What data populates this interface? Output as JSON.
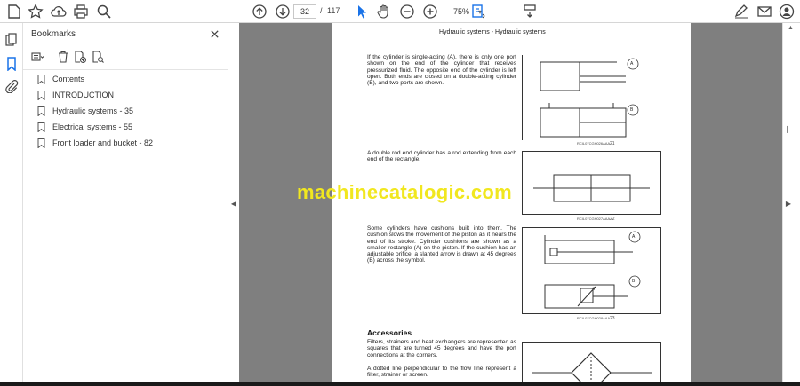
{
  "toolbar": {
    "current_page": "32",
    "page_separator": "/",
    "total_pages": "117",
    "zoom": "75%"
  },
  "bookmarks": {
    "title": "Bookmarks",
    "items": [
      {
        "label": "Contents"
      },
      {
        "label": "INTRODUCTION"
      },
      {
        "label": "Hydraulic systems - 35"
      },
      {
        "label": "Electrical systems - 55"
      },
      {
        "label": "Front loader and bucket - 82"
      }
    ]
  },
  "document": {
    "header": "Hydraulic systems - Hydraulic systems",
    "para1": "If the cylinder is single-acting (A), there is only one port shown on the end of the cylinder that receives pressurized fluid. The opposite end of the cylinder is left open. Both ends are closed on a double-acting cylinder (B), and two ports are shown.",
    "fig1_caption": "RCIL07CGH026AAA",
    "fig1_number": "21",
    "fig1_label_a": "A",
    "fig1_label_b": "B",
    "para2": "A double rod end cylinder has a rod extending from each end of the rectangle.",
    "fig2_caption": "RCIL07CGH027AAA",
    "fig2_number": "22",
    "para3": "Some cylinders have cushions built into them. The cushion slows the movement of the piston as it nears the end of its stroke. Cylinder cushions are shown as a smaller rectangle (A) on the piston. If the cushion has an adjustable orifice, a slanted arrow is drawn at 45 degrees (B) across the symbol.",
    "fig3_caption": "RCIL07CGH028AAA",
    "fig3_number": "23",
    "fig3_label_a": "A",
    "fig3_label_b": "B",
    "accessories_heading": "Accessories",
    "para4": "Filters, strainers and heat exchangers are represented as squares that are turned 45 degrees and have the port connections at the corners.",
    "para5": "A dotted line perpendicular to the flow line represent a filter, strainer or screen."
  },
  "watermark": "machinecatalogic.com"
}
